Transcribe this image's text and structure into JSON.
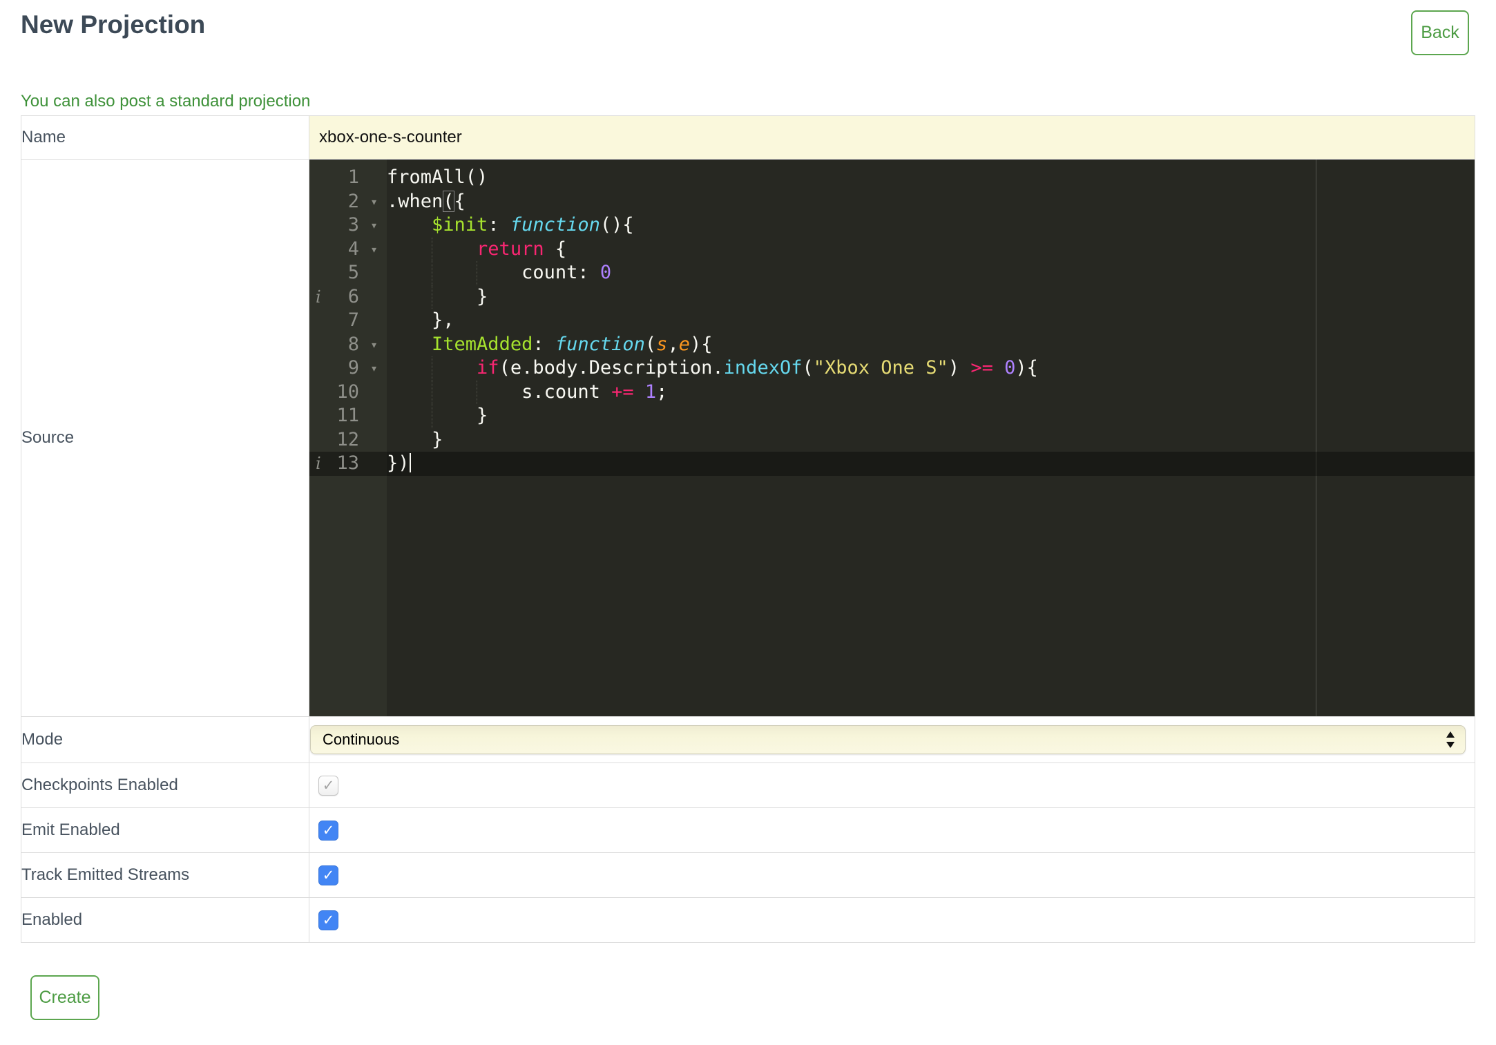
{
  "header": {
    "title": "New Projection",
    "back_label": "Back",
    "link_text": "You can also post a standard projection"
  },
  "form": {
    "name": {
      "label": "Name",
      "value": "xbox-one-s-counter"
    },
    "source": {
      "label": "Source"
    },
    "mode": {
      "label": "Mode",
      "value": "Continuous"
    },
    "checkpoints": {
      "label": "Checkpoints Enabled",
      "checked": true,
      "disabled": true
    },
    "emit": {
      "label": "Emit Enabled",
      "checked": true,
      "disabled": false
    },
    "track": {
      "label": "Track Emitted Streams",
      "checked": true,
      "disabled": false
    },
    "enabled": {
      "label": "Enabled",
      "checked": true,
      "disabled": false
    }
  },
  "footer": {
    "create_label": "Create"
  },
  "editor": {
    "language": "javascript",
    "line_count": 13,
    "lines": [
      {
        "n": 1,
        "fold": false,
        "info": false,
        "active": false,
        "seg": [
          [
            "p",
            "fromAll()"
          ]
        ]
      },
      {
        "n": 2,
        "fold": true,
        "info": false,
        "active": false,
        "seg": [
          [
            "p",
            ".when"
          ],
          [
            "m",
            "("
          ],
          [
            "p",
            "{"
          ]
        ]
      },
      {
        "n": 3,
        "fold": true,
        "info": false,
        "active": false,
        "seg": [
          [
            "p",
            "    "
          ],
          [
            "g",
            "$init"
          ],
          [
            "p",
            ": "
          ],
          [
            "ci",
            "function"
          ],
          [
            "p",
            "(){"
          ]
        ]
      },
      {
        "n": 4,
        "fold": true,
        "info": false,
        "active": false,
        "seg": [
          [
            "p",
            "        "
          ],
          [
            "pk",
            "return"
          ],
          [
            "p",
            " {"
          ]
        ]
      },
      {
        "n": 5,
        "fold": false,
        "info": false,
        "active": false,
        "seg": [
          [
            "p",
            "            count: "
          ],
          [
            "nm",
            "0"
          ]
        ]
      },
      {
        "n": 6,
        "fold": false,
        "info": true,
        "active": false,
        "seg": [
          [
            "p",
            "        }"
          ]
        ]
      },
      {
        "n": 7,
        "fold": false,
        "info": false,
        "active": false,
        "seg": [
          [
            "p",
            "    },"
          ]
        ]
      },
      {
        "n": 8,
        "fold": true,
        "info": false,
        "active": false,
        "seg": [
          [
            "p",
            "    "
          ],
          [
            "g",
            "ItemAdded"
          ],
          [
            "p",
            ": "
          ],
          [
            "ci",
            "function"
          ],
          [
            "p",
            "("
          ],
          [
            "o",
            "s"
          ],
          [
            "p",
            ","
          ],
          [
            "o",
            "e"
          ],
          [
            "p",
            "){"
          ]
        ]
      },
      {
        "n": 9,
        "fold": true,
        "info": false,
        "active": false,
        "seg": [
          [
            "p",
            "        "
          ],
          [
            "pk",
            "if"
          ],
          [
            "p",
            "(e.body.Description."
          ],
          [
            "cy",
            "indexOf"
          ],
          [
            "p",
            "("
          ],
          [
            "s",
            "\"Xbox One S\""
          ],
          [
            "p",
            ") "
          ],
          [
            "pk",
            ">="
          ],
          [
            "p",
            " "
          ],
          [
            "nm",
            "0"
          ],
          [
            "p",
            "){"
          ]
        ]
      },
      {
        "n": 10,
        "fold": false,
        "info": false,
        "active": false,
        "seg": [
          [
            "p",
            "            s.count "
          ],
          [
            "pk",
            "+="
          ],
          [
            "p",
            " "
          ],
          [
            "nm",
            "1"
          ],
          [
            "p",
            ";"
          ]
        ]
      },
      {
        "n": 11,
        "fold": false,
        "info": false,
        "active": false,
        "seg": [
          [
            "p",
            "        }"
          ]
        ]
      },
      {
        "n": 12,
        "fold": false,
        "info": false,
        "active": false,
        "seg": [
          [
            "p",
            "    }"
          ]
        ]
      },
      {
        "n": 13,
        "fold": false,
        "info": true,
        "active": true,
        "cursor": true,
        "seg": [
          [
            "p",
            "})"
          ]
        ]
      }
    ]
  },
  "colors": {
    "accent_green": "#4D9C44",
    "button_border_green": "#5CA64F",
    "link_green": "#3E9139",
    "heading_slate": "#3C4956",
    "label_slate": "#47525E",
    "input_yellow_bg": "#FAF8DC",
    "select_cream_bg": "#F6F4D8",
    "checkbox_blue": "#4285F4",
    "editor_bg": "#272822",
    "editor_gutter_bg": "#2F3129",
    "editor_text": "#F8F8F2",
    "editor_active_line": "rgba(0,0,0,0.35)",
    "token_green": "#A6E22E",
    "token_cyan": "#66D9EF",
    "token_pink": "#F92672",
    "token_purple": "#AE81FF",
    "token_yellow": "#E6DB74",
    "token_orange": "#FD971F",
    "line_number_gray": "#8F908A",
    "table_border": "#DCDCDC"
  }
}
